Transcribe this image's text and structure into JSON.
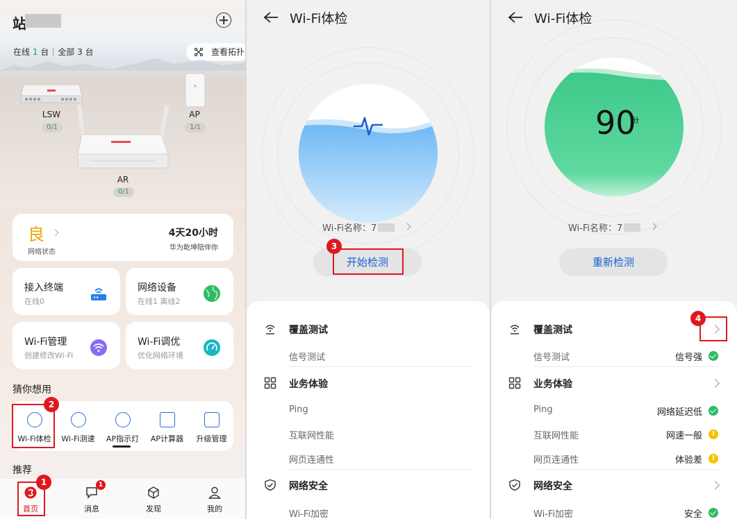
{
  "screen1": {
    "site_name": "站",
    "online_label": "在线",
    "online_count": "1",
    "total_label": "全部",
    "total_count": "3",
    "unit": "台",
    "topology_button": "查看拓扑",
    "devices": [
      {
        "name": "LSW",
        "online": "0",
        "total": "/1"
      },
      {
        "name": "AP",
        "online": "1",
        "total": "/1"
      },
      {
        "name": "AR",
        "online": "0",
        "total": "/1"
      }
    ],
    "status": {
      "grade": "良",
      "label": "网络状态",
      "uptime": "4天20小时",
      "uptime_sub": "华为乾坤陪伴你"
    },
    "tiles": [
      {
        "title": "接入终端",
        "sub": "在线0",
        "icon": "router-icon",
        "color": "#2b7de9"
      },
      {
        "title": "网络设备",
        "sub": "在线1 离线2",
        "icon": "globe-icon",
        "color": "#2fba63"
      },
      {
        "title": "Wi-Fi管理",
        "sub": "创建修改Wi-Fi",
        "icon": "wifi-icon",
        "color": "#8a6cf0"
      },
      {
        "title": "Wi-Fi调优",
        "sub": "优化网络环境",
        "icon": "gauge-icon",
        "color": "#19b5c4"
      }
    ],
    "guess_title": "猜你想用",
    "quick_items": [
      {
        "label": "Wi-Fi体检",
        "icon": "wifi-check-icon"
      },
      {
        "label": "Wi-Fi测速",
        "icon": "speed-icon"
      },
      {
        "label": "AP指示灯",
        "icon": "bulb-icon"
      },
      {
        "label": "AP计算器",
        "icon": "calculator-icon"
      },
      {
        "label": "升级管理",
        "icon": "upgrade-icon"
      }
    ],
    "recommend_title": "推荐",
    "tabs": [
      {
        "label": "首页",
        "icon": "home-icon"
      },
      {
        "label": "消息",
        "icon": "message-icon",
        "badge": "1"
      },
      {
        "label": "发现",
        "icon": "cube-icon"
      },
      {
        "label": "我的",
        "icon": "user-icon"
      }
    ]
  },
  "screen2": {
    "title": "Wi-Fi体检",
    "wifi_name_label": "Wi-Fi名称：7",
    "start_button": "开始检测",
    "sections": [
      {
        "title": "覆盖测试",
        "rows": [
          "信号测试"
        ]
      },
      {
        "title": "业务体验",
        "rows": [
          "Ping",
          "互联网性能",
          "网页连通性"
        ]
      },
      {
        "title": "网络安全",
        "rows": [
          "Wi-Fi加密"
        ]
      }
    ]
  },
  "screen3": {
    "title": "Wi-Fi体检",
    "score": "90",
    "score_unit": "分",
    "wifi_name_label": "Wi-Fi名称：7",
    "retest_button": "重新检测",
    "sections": [
      {
        "title": "覆盖测试",
        "rows": [
          {
            "label": "信号测试",
            "value": "信号强",
            "state": "ok"
          }
        ]
      },
      {
        "title": "业务体验",
        "rows": [
          {
            "label": "Ping",
            "value": "网络延迟低",
            "state": "ok"
          },
          {
            "label": "互联网性能",
            "value": "网速一般",
            "state": "warn"
          },
          {
            "label": "网页连通性",
            "value": "体验差",
            "state": "warn"
          }
        ]
      },
      {
        "title": "网络安全",
        "rows": [
          {
            "label": "Wi-Fi加密",
            "value": "安全",
            "state": "ok"
          }
        ]
      }
    ]
  },
  "markers": [
    "1",
    "2",
    "3",
    "4"
  ],
  "colors": {
    "accent_blue": "#1a5fd6",
    "highlight_red": "#e0181e",
    "ok_green": "#2fba63",
    "warn_yellow": "#f5c400",
    "grade_orange": "#f0a400"
  }
}
